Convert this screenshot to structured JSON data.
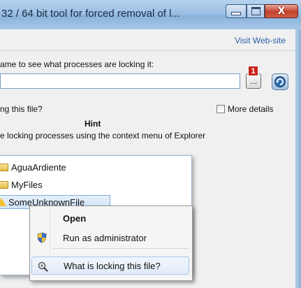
{
  "window": {
    "title": "32 / 64 bit tool for forced removal of l...",
    "close_symbol": "X"
  },
  "header": {
    "visit_link": "Visit Web-site"
  },
  "file_select": {
    "prompt": "ame to see what processes are locking it:",
    "path_value": "",
    "browse_label": "...",
    "badge": "1"
  },
  "options": {
    "question": "ng this file?",
    "more_details_label": "More details",
    "more_details_checked": false
  },
  "hint": {
    "title": "Hint",
    "text": "e locking processes using the context menu of Explorer"
  },
  "explorer": {
    "items": [
      {
        "name": "AguaArdiente",
        "icon": "folder-icon"
      },
      {
        "name": "MyFiles",
        "icon": "folder-icon"
      },
      {
        "name": "SomeUnknownFile",
        "icon": "warning-icon"
      }
    ]
  },
  "context_menu": {
    "items": [
      {
        "label": "Open",
        "icon": ""
      },
      {
        "label": "Run as administrator",
        "icon": "uac-shield-icon"
      },
      {
        "label": "What is locking this file?",
        "icon": "magnifier-gear-icon"
      }
    ]
  },
  "colors": {
    "title_bar": "#9cc0e3",
    "link": "#2b5fa8",
    "badge": "#c8221a",
    "close_button": "#c2402a"
  }
}
